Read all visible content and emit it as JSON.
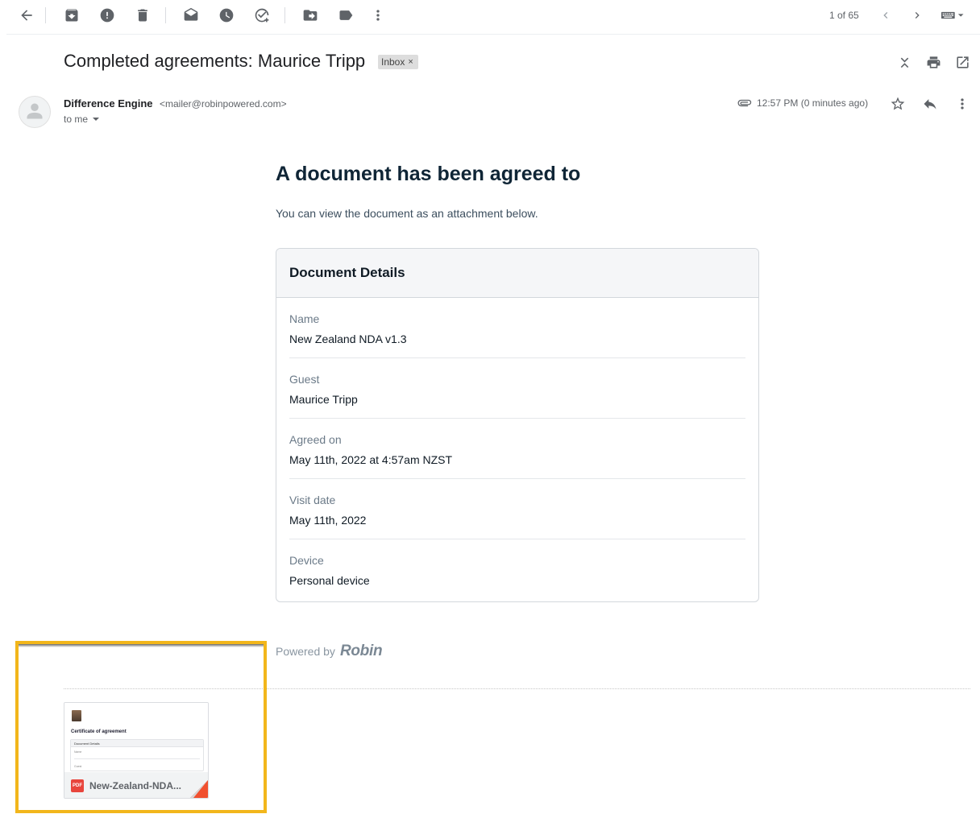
{
  "toolbar": {
    "pager_text": "1 of 65",
    "icons": [
      "back-arrow-icon",
      "archive-icon",
      "report-spam-icon",
      "delete-icon",
      "mark-unread-icon",
      "snooze-icon",
      "add-to-tasks-icon",
      "move-to-icon",
      "label-icon",
      "more-vert-icon",
      "chevron-left-icon",
      "chevron-right-icon",
      "keyboard-icon"
    ]
  },
  "email": {
    "subject": "Completed agreements: Maurice Tripp",
    "label_badge": "Inbox",
    "label_close": "×",
    "sender_name": "Difference Engine",
    "sender_email": "<mailer@robinpowered.com>",
    "recipient": "to me",
    "time": "12:57 PM (0 minutes ago)"
  },
  "body": {
    "headline": "A document has been agreed to",
    "intro": "You can view the document as an attachment below.",
    "card_title": "Document Details",
    "details": [
      {
        "label": "Name",
        "value": "New Zealand NDA v1.3"
      },
      {
        "label": "Guest",
        "value": "Maurice Tripp"
      },
      {
        "label": "Agreed on",
        "value": "May 11th, 2022 at 4:57am NZST"
      },
      {
        "label": "Visit date",
        "value": "May 11th, 2022"
      },
      {
        "label": "Device",
        "value": "Personal device"
      }
    ],
    "powered_by": "Powered by",
    "brand": "Robin"
  },
  "attachment": {
    "file_name": "New-Zealand-NDA...",
    "file_type": "PDF",
    "preview_title": "Certificate of agreement",
    "preview_card_header": "Document Details",
    "preview_line1": "Name",
    "preview_line2": "Guest"
  },
  "colors": {
    "highlight": "#f2b61b",
    "pdf_red": "#e8453c",
    "headline": "#0f2536"
  }
}
